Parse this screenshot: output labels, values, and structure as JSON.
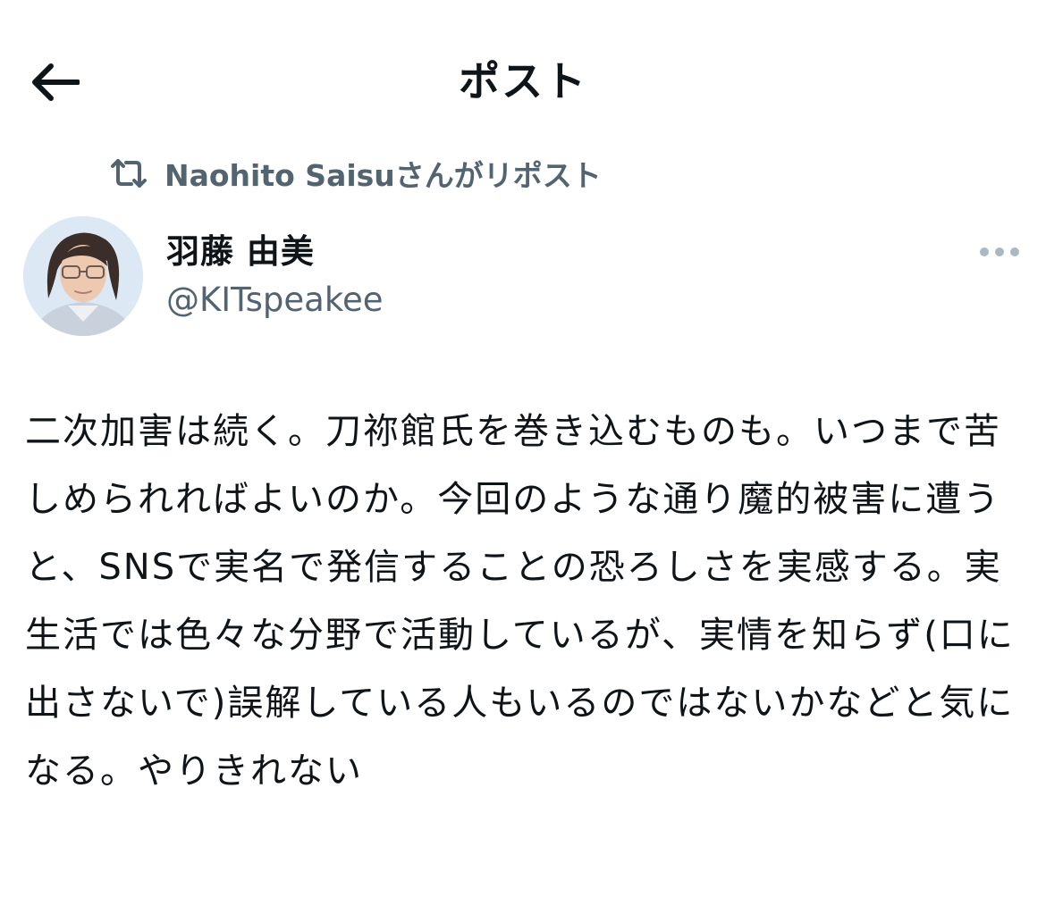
{
  "header": {
    "title": "ポスト",
    "back_icon": "arrow-left-icon"
  },
  "repost": {
    "icon": "repost-icon",
    "text": "Naohito Saisuさんがリポスト"
  },
  "author": {
    "name": "羽藤 由美",
    "handle": "@KITspeakee",
    "avatar_icon": "avatar-photo"
  },
  "more": {
    "icon": "more-horizontal-icon"
  },
  "post": {
    "text": "二次加害は続く。刀祢館氏を巻き込むものも。いつまで苦しめられればよいのか。今回のような通り魔的被害に遭うと、SNSで実名で発信することの恐ろしさを実感する。実生活では色々な分野で活動しているが、実情を知らず(口に出さないで)誤解している人もいるのではないかなどと気になる。やりきれない"
  },
  "colors": {
    "text_primary": "#0f1419",
    "text_secondary": "#536471"
  }
}
